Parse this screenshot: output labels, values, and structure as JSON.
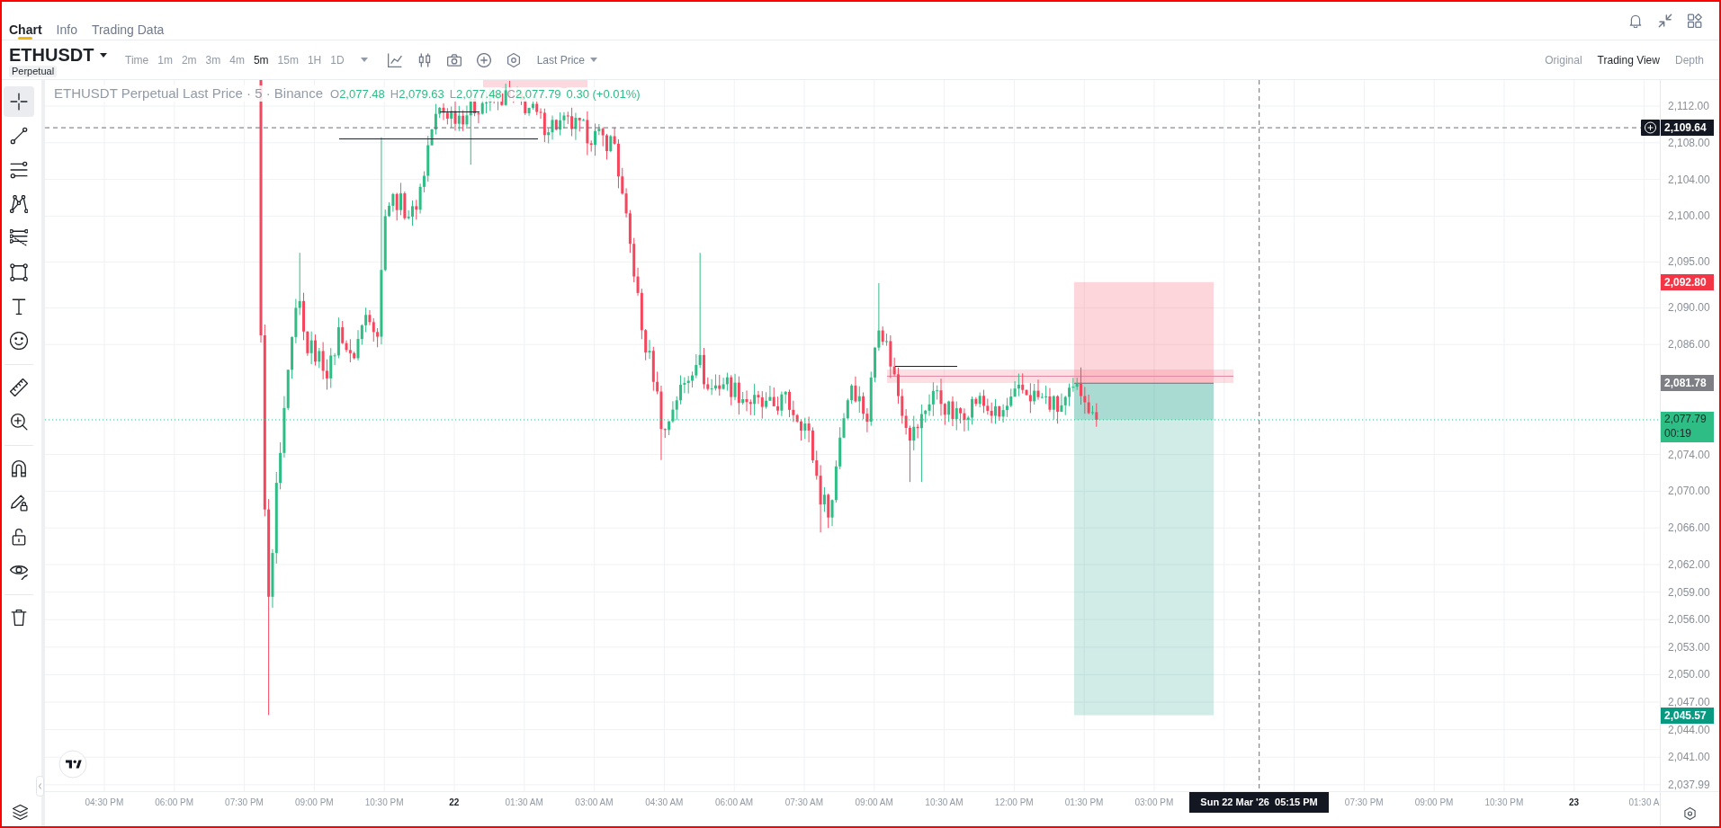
{
  "tabs": [
    {
      "label": "Chart",
      "selected": true
    },
    {
      "label": "Info",
      "selected": false
    },
    {
      "label": "Trading Data",
      "selected": false
    }
  ],
  "toolbar": {
    "symbol": "ETHUSDT",
    "contract_type": "Perpetual",
    "intervals": [
      {
        "label": "Time",
        "selected": false
      },
      {
        "label": "1m",
        "selected": false
      },
      {
        "label": "2m",
        "selected": false
      },
      {
        "label": "3m",
        "selected": false
      },
      {
        "label": "4m",
        "selected": false
      },
      {
        "label": "5m",
        "selected": true
      },
      {
        "label": "15m",
        "selected": false
      },
      {
        "label": "1H",
        "selected": false
      },
      {
        "label": "1D",
        "selected": false
      }
    ],
    "price_source": "Last Price",
    "views": [
      {
        "label": "Original",
        "selected": false
      },
      {
        "label": "Trading View",
        "selected": true
      },
      {
        "label": "Depth",
        "selected": false
      }
    ]
  },
  "drawing_toolbar": {
    "groups": [
      {
        "tools": [
          {
            "kind": "crosshair",
            "selected": true
          },
          {
            "kind": "trendline",
            "selected": false
          },
          {
            "kind": "hlines",
            "selected": false
          },
          {
            "kind": "pattern",
            "selected": false
          },
          {
            "kind": "levels",
            "selected": false
          },
          {
            "kind": "rectangle",
            "selected": false
          },
          {
            "kind": "text",
            "selected": false
          },
          {
            "kind": "emoji",
            "selected": false
          }
        ]
      },
      {
        "tools": [
          {
            "kind": "ruler",
            "selected": false
          },
          {
            "kind": "zoom",
            "selected": false
          }
        ]
      },
      {
        "tools": [
          {
            "kind": "magnet",
            "selected": false
          },
          {
            "kind": "drawlock",
            "selected": false
          },
          {
            "kind": "lock",
            "selected": false
          },
          {
            "kind": "visibility",
            "selected": false
          }
        ]
      },
      {
        "tools": [
          {
            "kind": "trash",
            "selected": false
          }
        ]
      }
    ]
  },
  "chart": {
    "legend": {
      "title": "ETHUSDT Perpetual Last Price · 5 · Binance",
      "ohlc": [
        {
          "label": "O",
          "value": "2,077.48"
        },
        {
          "label": "H",
          "value": "2,079.63"
        },
        {
          "label": "L",
          "value": "2,077.48"
        },
        {
          "label": "C",
          "value": "2,077.79"
        }
      ],
      "change": "0.30 (+0.01%)",
      "rising": true
    },
    "price_axis": {
      "labels": [
        "2,112.00",
        "2,108.00",
        "2,104.00",
        "2,100.00",
        "2,095.00",
        "2,090.00",
        "2,086.00",
        "2,074.00",
        "2,070.00",
        "2,066.00",
        "2,062.00",
        "2,059.00",
        "2,056.00",
        "2,053.00",
        "2,050.00",
        "2,047.00",
        "2,044.00",
        "2,041.00",
        "2,037.99"
      ],
      "tags": [
        {
          "kind": "crosshair",
          "text": "2,109.64"
        },
        {
          "kind": "stop_loss",
          "text": "2,092.80"
        },
        {
          "kind": "entry",
          "text": "2,081.78"
        },
        {
          "kind": "last",
          "text": "2,077.79",
          "countdown": "00:19"
        },
        {
          "kind": "take_profit",
          "text": "2,045.57"
        }
      ]
    },
    "time_axis": {
      "labels": [
        {
          "kind": "time",
          "text": "04:30 PM"
        },
        {
          "kind": "time",
          "text": "06:00 PM"
        },
        {
          "kind": "time",
          "text": "07:30 PM"
        },
        {
          "kind": "time",
          "text": "09:00 PM"
        },
        {
          "kind": "time",
          "text": "10:30 PM"
        },
        {
          "kind": "day",
          "text": "22"
        },
        {
          "kind": "time",
          "text": "01:30 AM"
        },
        {
          "kind": "time",
          "text": "03:00 AM"
        },
        {
          "kind": "time",
          "text": "04:30 AM"
        },
        {
          "kind": "time",
          "text": "06:00 AM"
        },
        {
          "kind": "time",
          "text": "07:30 AM"
        },
        {
          "kind": "time",
          "text": "09:00 AM"
        },
        {
          "kind": "time",
          "text": "10:30 AM"
        },
        {
          "kind": "time",
          "text": "12:00 PM"
        },
        {
          "kind": "time",
          "text": "01:30 PM"
        },
        {
          "kind": "time",
          "text": "03:00 PM"
        },
        {
          "kind": "crosshair",
          "text": "Sun 22 Mar '26  05:15 PM"
        },
        {
          "kind": "time",
          "text": "07:30 PM"
        },
        {
          "kind": "time",
          "text": "09:00 PM"
        },
        {
          "kind": "time",
          "text": "10:30 PM"
        },
        {
          "kind": "day",
          "text": "23"
        },
        {
          "kind": "time",
          "text": "01:30 A"
        }
      ]
    }
  }
}
